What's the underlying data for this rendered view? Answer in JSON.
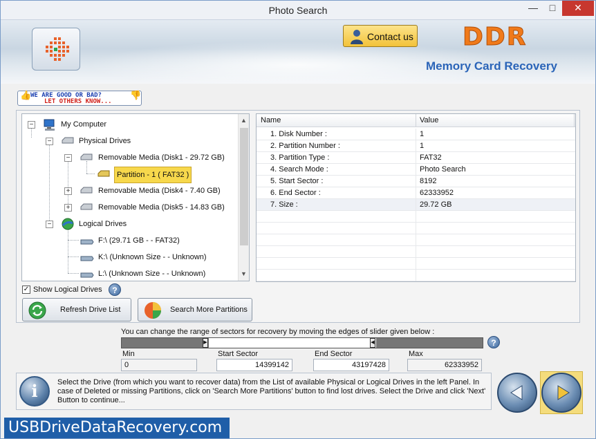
{
  "window": {
    "title": "Photo Search",
    "min": "—",
    "max": "□",
    "close": "✕"
  },
  "header": {
    "contact_label": "Contact us",
    "brand": "DDR",
    "subbrand": "Memory Card Recovery"
  },
  "feedback": {
    "line1": "WE ARE GOOD OR BAD?",
    "line2": "LET OTHERS KNOW..."
  },
  "tree": {
    "my_computer": "My Computer",
    "physical_drives": "Physical Drives",
    "disk1": "Removable Media (Disk1 - 29.72 GB)",
    "partition1": "Partition - 1 ( FAT32 )",
    "disk4": "Removable Media (Disk4 - 7.40 GB)",
    "disk5": "Removable Media (Disk5 - 14.83 GB)",
    "logical_drives": "Logical Drives",
    "drive_f": "F:\\ (29.71 GB -  - FAT32)",
    "drive_k": "K:\\ (Unknown Size  -  - Unknown)",
    "drive_l": "L:\\ (Unknown Size  -  - Unknown)"
  },
  "grid": {
    "col_name": "Name",
    "col_value": "Value",
    "rows": [
      {
        "name": "1. Disk Number :",
        "value": "1"
      },
      {
        "name": "2. Partition Number :",
        "value": "1"
      },
      {
        "name": "3. Partition Type :",
        "value": "FAT32"
      },
      {
        "name": "4. Search Mode :",
        "value": "Photo Search"
      },
      {
        "name": "5. Start Sector :",
        "value": "8192"
      },
      {
        "name": "6. End Sector :",
        "value": "62333952"
      },
      {
        "name": "7. Size :",
        "value": "29.72 GB"
      }
    ]
  },
  "options": {
    "show_logical": "Show Logical Drives",
    "show_logical_checked": true
  },
  "buttons": {
    "refresh": "Refresh Drive List",
    "search_more": "Search More Partitions"
  },
  "range": {
    "instruction": "You can change the range of sectors for recovery by moving the edges of slider given below :",
    "min_label": "Min",
    "min_value": "0",
    "start_label": "Start Sector",
    "start_value": "14399142",
    "end_label": "End Sector",
    "end_value": "43197428",
    "max_label": "Max",
    "max_value": "62333952"
  },
  "info": {
    "text": "Select the Drive (from which you want to recover data) from the List of available Physical or Logical Drives in the left Panel. In case of Deleted or missing Partitions, click on 'Search More Partitions' button to find lost drives. Select the Drive and click 'Next' Button to continue..."
  },
  "footer": {
    "site": "USBDriveDataRecovery.com"
  },
  "colors": {
    "accent": "#2a64b8",
    "brand": "#f07a1a",
    "selection": "#f7d84c",
    "footer": "#1f5ea8"
  }
}
